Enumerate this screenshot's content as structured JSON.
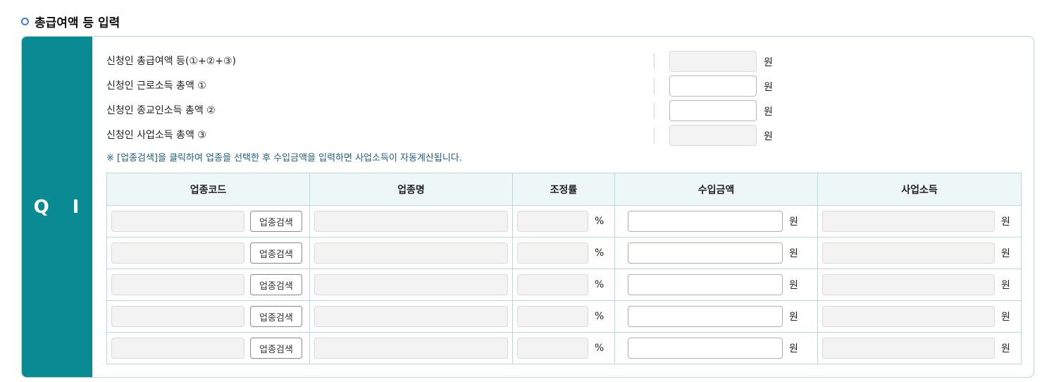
{
  "section": {
    "title": "총급여액 등 입력",
    "bullet_icon": "circle-bullet-icon"
  },
  "panel": {
    "side_label": "Q I"
  },
  "summary_rows": [
    {
      "label": "신청인 총급여액 등(①+②+③)",
      "value": "",
      "readonly": true,
      "unit": "원"
    },
    {
      "label": "신청인 근로소득 총액 ①",
      "value": "",
      "readonly": false,
      "unit": "원"
    },
    {
      "label": "신청인 종교인소득 총액 ②",
      "value": "",
      "readonly": false,
      "unit": "원"
    },
    {
      "label": "신청인 사업소득 총액 ③",
      "value": "",
      "readonly": true,
      "unit": "원"
    }
  ],
  "notice": "※ [업종검색]을 클릭하여 업종을 선택한 후 수입금액을 입력하면 사업소득이 자동계산됩니다.",
  "table": {
    "headers": [
      "업종코드",
      "업종명",
      "조정률",
      "수입금액",
      "사업소득"
    ],
    "search_button": "업종검색",
    "percent_unit": "%",
    "won_unit": "원",
    "rows": [
      {
        "code": "",
        "name": "",
        "rate": "",
        "income": "",
        "profit": ""
      },
      {
        "code": "",
        "name": "",
        "rate": "",
        "income": "",
        "profit": ""
      },
      {
        "code": "",
        "name": "",
        "rate": "",
        "income": "",
        "profit": ""
      },
      {
        "code": "",
        "name": "",
        "rate": "",
        "income": "",
        "profit": ""
      },
      {
        "code": "",
        "name": "",
        "rate": "",
        "income": "",
        "profit": ""
      }
    ]
  },
  "colors": {
    "accent": "#0a8b94",
    "border": "#b9d8da",
    "header_bg": "#edf7f7",
    "notice": "#1c5e86",
    "bullet": "#3d7ee0"
  }
}
